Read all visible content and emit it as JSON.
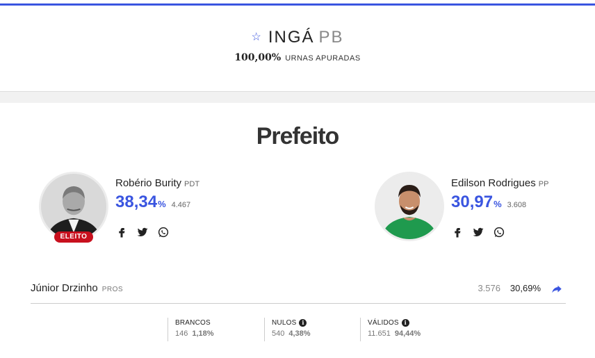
{
  "header": {
    "city": "INGÁ",
    "uf": "PB",
    "progress_pct": "100,00%",
    "progress_label": "URNAS APURADAS"
  },
  "section": {
    "title": "Prefeito"
  },
  "candidates": [
    {
      "name": "Robério Burity",
      "party": "PDT",
      "pct": "38,34",
      "votes": "4.467",
      "badge": "ELEITO"
    },
    {
      "name": "Edilson Rodrigues",
      "party": "PP",
      "pct": "30,97",
      "votes": "3.608"
    }
  ],
  "pct_sign": "%",
  "others": [
    {
      "name": "Júnior Drzinho",
      "party": "PROS",
      "votes": "3.576",
      "pct": "30,69%"
    }
  ],
  "totals": {
    "brancos": {
      "label": "BRANCOS",
      "votes": "146",
      "pct": "1,18%"
    },
    "nulos": {
      "label": "NULOS",
      "votes": "540",
      "pct": "4,38%"
    },
    "validos": {
      "label": "VÁLIDOS",
      "votes": "11.651",
      "pct": "94,44%"
    }
  },
  "colors": {
    "accent": "#3a55e0",
    "elected": "#c8101e"
  },
  "icons": [
    "star-icon",
    "facebook-icon",
    "twitter-icon",
    "whatsapp-icon",
    "share-icon",
    "info-icon"
  ]
}
